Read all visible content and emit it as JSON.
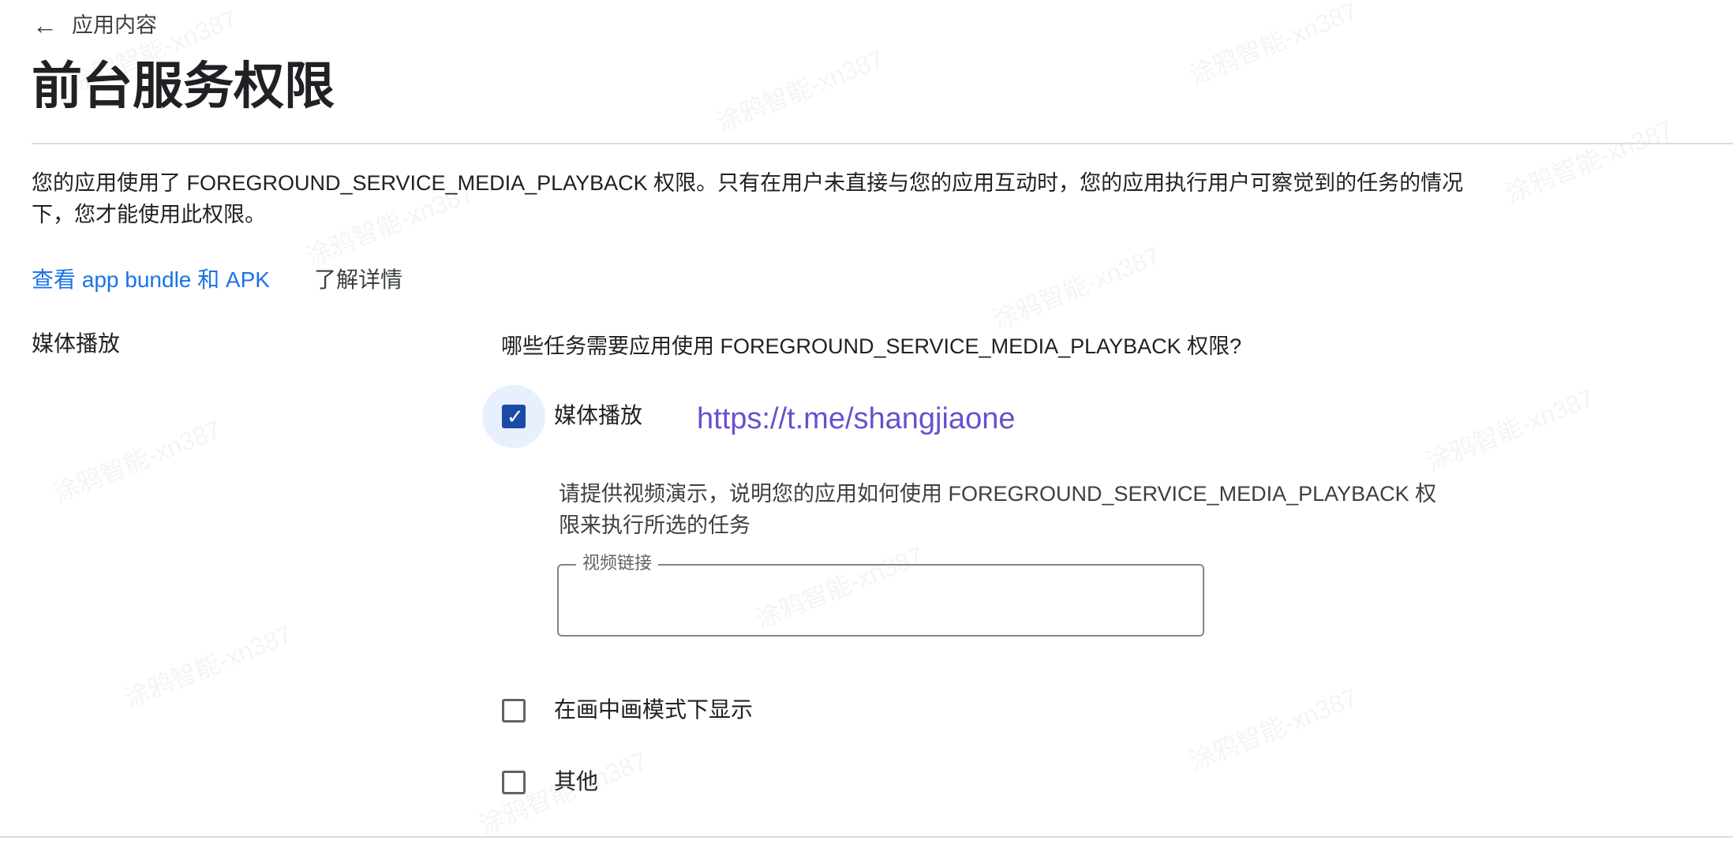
{
  "header": {
    "back_label": "应用内容",
    "title": "前台服务权限"
  },
  "description": "您的应用使用了 FOREGROUND_SERVICE_MEDIA_PLAYBACK 权限。只有在用户未直接与您的应用互动时，您的应用执行用户可察觉到的任务的情况下，您才能使用此权限。",
  "links": {
    "bundle": "查看 app bundle 和 APK",
    "learn_more": "了解详情"
  },
  "section": {
    "label": "媒体播放",
    "question": "哪些任务需要应用使用 FOREGROUND_SERVICE_MEDIA_PLAYBACK 权限?",
    "options": [
      {
        "label": "媒体播放",
        "checked": true
      },
      {
        "label": "在画中画模式下显示",
        "checked": false
      },
      {
        "label": "其他",
        "checked": false
      }
    ],
    "overlay_link": "https://t.me/shangjiaone",
    "video_prompt": "请提供视频演示，说明您的应用如何使用 FOREGROUND_SERVICE_MEDIA_PLAYBACK 权限来执行所选的任务",
    "video_field": {
      "label": "视频链接",
      "value": ""
    }
  },
  "watermark": "涂鸦智能-xn387",
  "colors": {
    "accent": "#1a73e8",
    "checkbox_checked": "#1a4ba6",
    "link_overlay": "#6a4fd0"
  }
}
